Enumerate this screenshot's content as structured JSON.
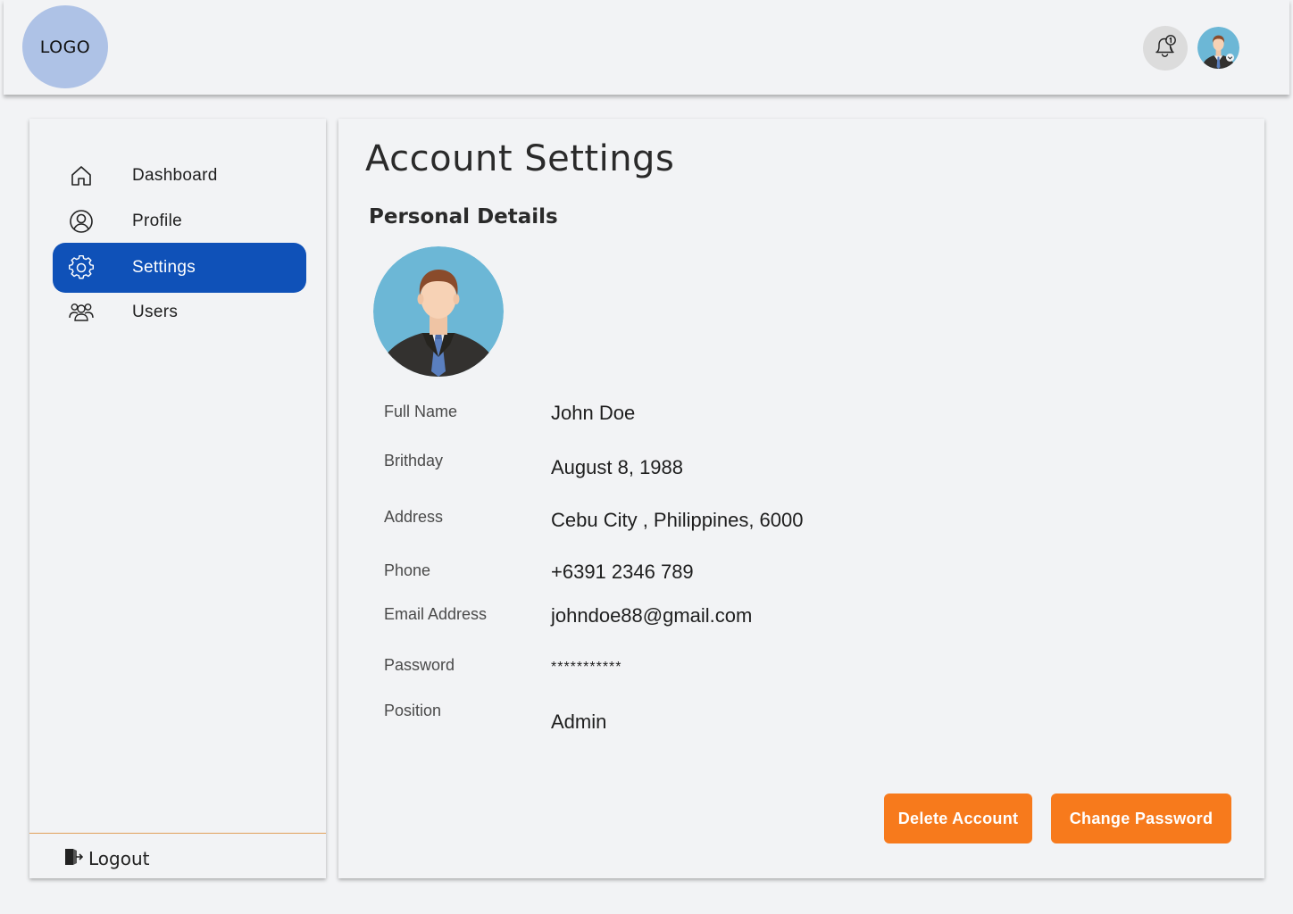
{
  "header": {
    "logo_text": "LOGO",
    "notification_icon": "bell-alert-icon",
    "avatar_icon": "user-avatar-icon"
  },
  "sidebar": {
    "items": [
      {
        "label": "Dashboard",
        "icon": "home-icon",
        "active": false
      },
      {
        "label": "Profile",
        "icon": "user-circle-icon",
        "active": false
      },
      {
        "label": "Settings",
        "icon": "gear-icon",
        "active": true
      },
      {
        "label": "Users",
        "icon": "users-icon",
        "active": false
      }
    ],
    "logout_label": "Logout",
    "logout_icon": "logout-icon"
  },
  "main": {
    "title": "Account Settings",
    "section_title": "Personal Details",
    "fields": [
      {
        "label": "Full Name",
        "value": "John Doe"
      },
      {
        "label": "Brithday",
        "value": "August 8, 1988"
      },
      {
        "label": "Address",
        "value": "Cebu City , Philippines, 6000"
      },
      {
        "label": "Phone",
        "value": "+6391 2346 789"
      },
      {
        "label": "Email Address",
        "value": "johndoe88@gmail.com"
      },
      {
        "label": "Password",
        "value": "***********"
      },
      {
        "label": "Position",
        "value": "Admin"
      }
    ],
    "buttons": {
      "delete_label": "Delete Account",
      "change_password_label": "Change Password"
    }
  },
  "colors": {
    "background": "#f2f3f5",
    "active_nav": "#0f51b8",
    "accent_button": "#f77a1c",
    "logo_circle": "#aec2e6",
    "divider": "#e0a05a"
  }
}
